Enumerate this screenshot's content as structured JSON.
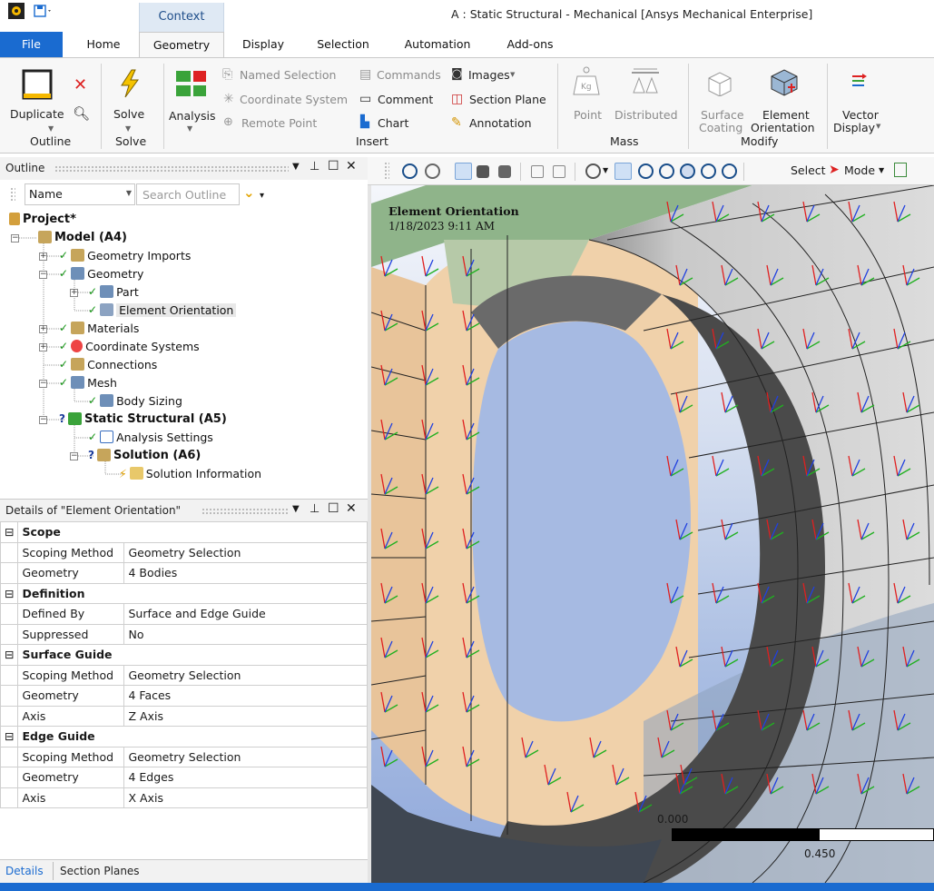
{
  "window": {
    "title": "A : Static Structural - Mechanical [Ansys Mechanical Enterprise]",
    "context_tab": "Context"
  },
  "tabs": [
    "File",
    "Home",
    "Geometry",
    "Display",
    "Selection",
    "Automation",
    "Add-ons"
  ],
  "ribbon": {
    "outline_group": {
      "duplicate": "Duplicate",
      "label": "Outline"
    },
    "solve_group": {
      "solve": "Solve",
      "label": "Solve"
    },
    "insert_group": {
      "analysis": "Analysis",
      "named_selection": "Named Selection",
      "coordinate_system": "Coordinate System",
      "remote_point": "Remote Point",
      "commands": "Commands",
      "comment": "Comment",
      "chart": "Chart",
      "images": "Images",
      "section_plane": "Section Plane",
      "annotation": "Annotation",
      "label": "Insert"
    },
    "mass_group": {
      "point": "Point",
      "distributed": "Distributed",
      "label": "Mass"
    },
    "modify_group": {
      "surface": "Surface",
      "coating": "Coating",
      "element": "Element",
      "orientation": "Orientation",
      "label": "Modify"
    },
    "vector_group": {
      "vector": "Vector",
      "display": "Display"
    }
  },
  "outline": {
    "title": "Outline",
    "filter_name": "Name",
    "search_placeholder": "Search Outline",
    "tree": {
      "project": "Project*",
      "model": "Model (A4)",
      "geometry_imports": "Geometry Imports",
      "geometry": "Geometry",
      "part": "Part",
      "element_orientation": "Element Orientation",
      "materials": "Materials",
      "coordinate_systems": "Coordinate Systems",
      "connections": "Connections",
      "mesh": "Mesh",
      "body_sizing": "Body Sizing",
      "static_structural": "Static Structural (A5)",
      "analysis_settings": "Analysis Settings",
      "solution": "Solution (A6)",
      "solution_information": "Solution Information"
    }
  },
  "details": {
    "title": "Details of \"Element Orientation\"",
    "sections": [
      {
        "name": "Scope",
        "rows": [
          [
            "Scoping Method",
            "Geometry Selection"
          ],
          [
            "Geometry",
            "4 Bodies"
          ]
        ]
      },
      {
        "name": "Definition",
        "rows": [
          [
            "Defined By",
            "Surface and Edge Guide"
          ],
          [
            "Suppressed",
            "No"
          ]
        ]
      },
      {
        "name": "Surface Guide",
        "rows": [
          [
            "Scoping Method",
            "Geometry Selection"
          ],
          [
            "Geometry",
            "4 Faces"
          ],
          [
            "Axis",
            "Z Axis"
          ]
        ]
      },
      {
        "name": "Edge Guide",
        "rows": [
          [
            "Scoping Method",
            "Geometry Selection"
          ],
          [
            "Geometry",
            "4 Edges"
          ],
          [
            "Axis",
            "X Axis"
          ]
        ]
      }
    ],
    "bottom_tabs": [
      "Details",
      "Section Planes"
    ]
  },
  "viewport": {
    "toolbar_select": "Select",
    "toolbar_mode": "Mode",
    "title": "Element Orientation",
    "date": "1/18/2023 9:11 AM",
    "scale_min": "0.000",
    "scale_mid": "0.450"
  },
  "colors": {
    "accent": "#1a6bd0",
    "ribbon": "#f7f7f7",
    "check": "#1a9a1a"
  }
}
